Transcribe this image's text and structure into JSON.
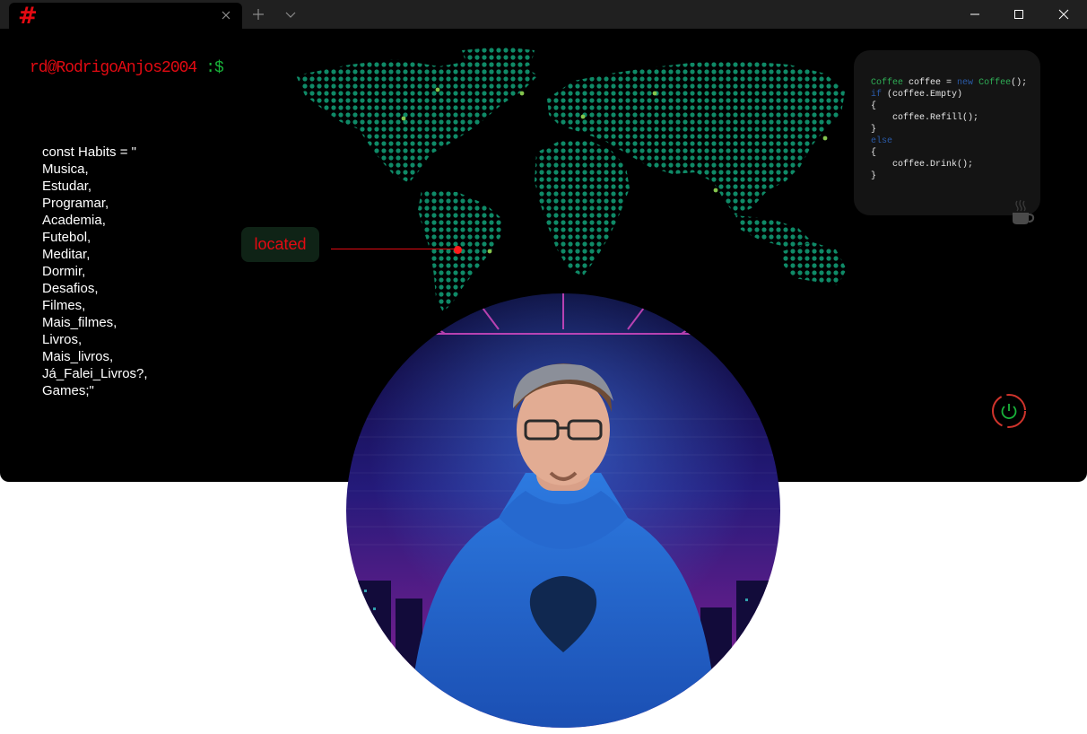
{
  "window": {
    "tab_logo": "#",
    "tab_close_icon": "close-icon",
    "new_tab_icon": "plus-icon",
    "dropdown_icon": "chevron-down-icon",
    "controls": [
      "minimize-icon",
      "maximize-icon",
      "close-icon"
    ]
  },
  "prompt": {
    "user": "rd@RodrigoAnjos2004",
    "symbol": ":$"
  },
  "habits": {
    "header": "const Habits = \"",
    "items": [
      "Musica,",
      "Estudar,",
      "Programar,",
      "Academia,",
      "Futebol,",
      "Meditar,",
      "Dormir,",
      "Desafios,",
      "Filmes,",
      "Mais_filmes,",
      "Livros,",
      "Mais_livros,",
      "Já_Falei_Livros?,",
      "Games;\""
    ]
  },
  "map": {
    "marker_label": "located",
    "dot_color": "#0f8a67",
    "marker_color": "#e30a12"
  },
  "code": {
    "line1_type": "Coffee",
    "line1_rest": " coffee = ",
    "line1_kw": "new",
    "line1_type2": "Coffee",
    "line1_end": "();",
    "line2_kw": "if",
    "line2_rest": " (coffee.Empty)",
    "line3": "{",
    "line4": "    coffee.Refill();",
    "line5": "}",
    "line6_kw": "else",
    "line7": "{",
    "line8": "    coffee.Drink();",
    "line9": "}"
  },
  "icons": {
    "coffee": "coffee-cup-icon",
    "power": "power-icon"
  },
  "colors": {
    "accent_red": "#e30a12",
    "accent_green": "#19b33a",
    "code_type": "#2fae56",
    "code_keyword": "#2a5aa8"
  }
}
